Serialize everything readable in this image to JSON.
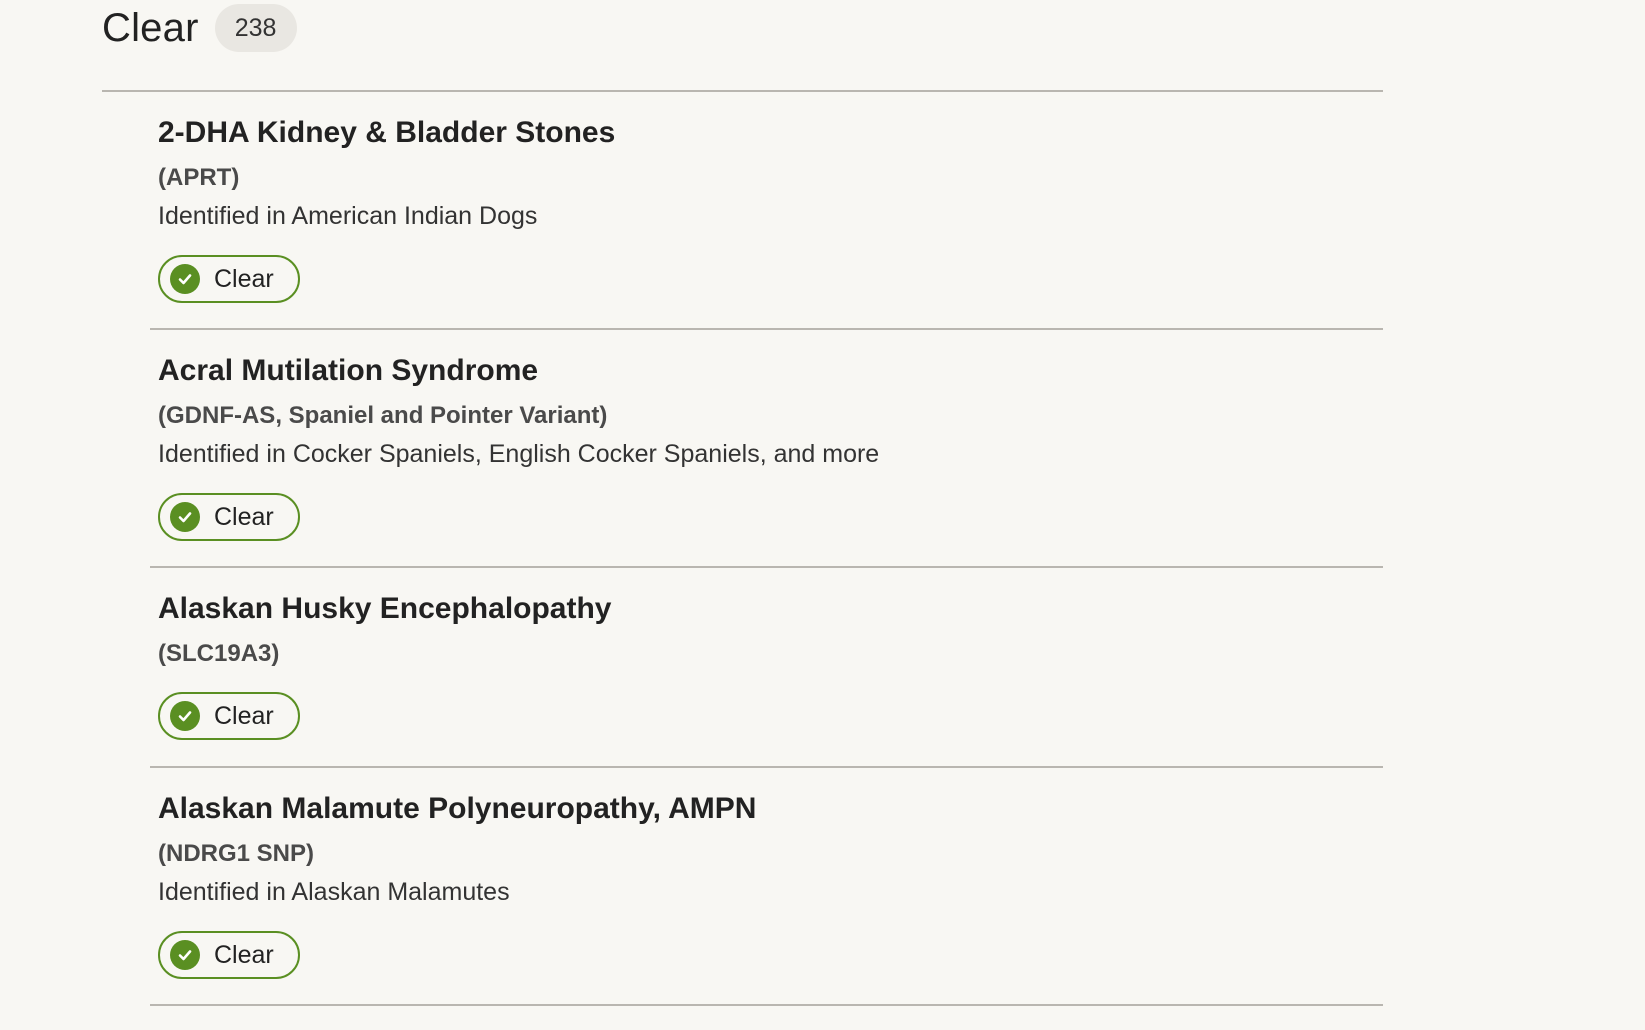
{
  "section": {
    "title": "Clear",
    "count": "238"
  },
  "conditions": [
    {
      "name": "2-DHA Kidney & Bladder Stones",
      "gene": "(APRT)",
      "breeds": "Identified in American Indian Dogs",
      "status": "Clear"
    },
    {
      "name": "Acral Mutilation Syndrome",
      "gene": "(GDNF-AS, Spaniel and Pointer Variant)",
      "breeds": "Identified in Cocker Spaniels, English Cocker Spaniels, and more",
      "status": "Clear"
    },
    {
      "name": "Alaskan Husky Encephalopathy",
      "gene": "(SLC19A3)",
      "breeds": "",
      "status": "Clear"
    },
    {
      "name": "Alaskan Malamute Polyneuropathy, AMPN",
      "gene": "(NDRG1 SNP)",
      "breeds": "Identified in Alaskan Malamutes",
      "status": "Clear"
    }
  ],
  "colors": {
    "status_clear": "#5a8f22",
    "background": "#f8f7f3",
    "divider": "#b9b6b0",
    "badge_background": "#e9e7e2"
  },
  "icons": {
    "status_clear": "check-circle-icon"
  }
}
